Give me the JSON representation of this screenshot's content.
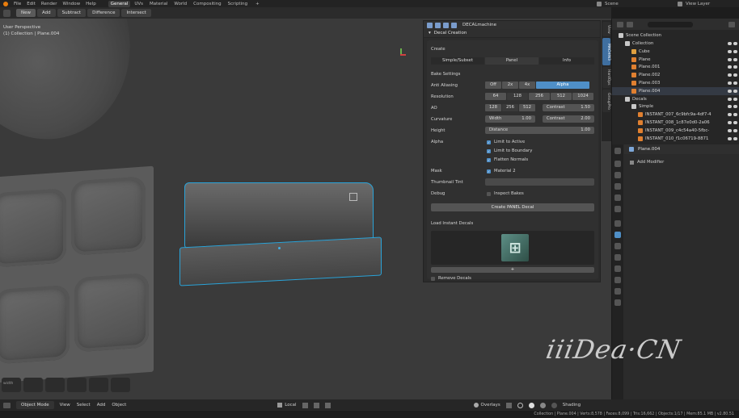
{
  "menus": [
    "File",
    "Edit",
    "Render",
    "Window",
    "Help"
  ],
  "workspaces": [
    "General",
    "UVs",
    "Material",
    "World",
    "Compositing",
    "Scripting"
  ],
  "active_workspace": "General",
  "add_tab_glyph": "+",
  "scene_name": "Scene",
  "view_layer": "View Layer",
  "mode_buttons": [
    "New",
    "Add",
    "Subtract",
    "Difference",
    "Intersect"
  ],
  "viewport": {
    "title": "User Perspective",
    "subtitle": "(1) Collection | Plane.004",
    "hud_text": "width"
  },
  "npanel": {
    "addon_name": "DECALmachine",
    "section": "Decal Creation",
    "create_label": "Create",
    "create_tabs": [
      "Simple/Subset",
      "Panel",
      "Info"
    ],
    "create_active": "Panel",
    "bake_settings": "Bake Settings",
    "anti_aliasing": {
      "label": "Anti Aliasing",
      "options": [
        "Off",
        "2x",
        "4x",
        "Alpha"
      ],
      "active": "Alpha"
    },
    "resolution": {
      "label": "Resolution",
      "options": [
        "64",
        "128",
        "256",
        "512",
        "1024"
      ],
      "active": "128"
    },
    "ao": {
      "label": "AO",
      "options": [
        "128",
        "256",
        "512"
      ],
      "active": "256",
      "contrast_label": "Contrast",
      "contrast_value": "1.50"
    },
    "curvature": {
      "label": "Curvature",
      "width_label": "Width",
      "width_value": "1.00",
      "contrast_label": "Contrast",
      "contrast_value": "2.00"
    },
    "height": {
      "label": "Height",
      "field_label": "Distance",
      "field_value": "1.00"
    },
    "alpha": {
      "label": "Alpha",
      "checks": [
        "Limit to Active",
        "Limit to Boundary",
        "Flatten Normals"
      ]
    },
    "mask": {
      "label": "Mask",
      "check": "Material 2"
    },
    "thumbnail_tint": "Thumbnail Tint",
    "debug": {
      "label": "Debug",
      "check": "Inspect Bakes"
    },
    "create_button": "Create PANEL Decal",
    "load_label": "Load Instant Decals",
    "thumb_glyph": "⊞",
    "add_glyph": "+",
    "remove_label": "Remove Decals"
  },
  "vtabs": [
    "View",
    "MACHIN3",
    "HardOps",
    "GroupPro"
  ],
  "outliner": {
    "root": "Scene Collection",
    "items": [
      {
        "name": "Collection",
        "depth": 1,
        "type": "col"
      },
      {
        "name": "Cube",
        "depth": 2,
        "type": "mesh"
      },
      {
        "name": "Plane",
        "depth": 2,
        "type": "plane"
      },
      {
        "name": "Plane.001",
        "depth": 2,
        "type": "plane"
      },
      {
        "name": "Plane.002",
        "depth": 2,
        "type": "plane"
      },
      {
        "name": "Plane.003",
        "depth": 2,
        "type": "plane"
      },
      {
        "name": "Plane.004",
        "depth": 2,
        "type": "plane",
        "selected": true
      },
      {
        "name": "Decals",
        "depth": 1,
        "type": "col"
      },
      {
        "name": "Simple",
        "depth": 2,
        "type": "col"
      },
      {
        "name": "INSTANT_007_6c9bfc9a-4df7-4",
        "depth": 3,
        "type": "plane"
      },
      {
        "name": "INSTANT_008_1c87e0d0-2a06",
        "depth": 3,
        "type": "plane"
      },
      {
        "name": "INSTANT_009_c4c54a40-5fbc-",
        "depth": 3,
        "type": "plane"
      },
      {
        "name": "INSTANT_010_f1c06719-8871",
        "depth": 3,
        "type": "plane"
      }
    ]
  },
  "properties": {
    "object_name": "Plane.004",
    "add_modifier": "Add Modifier"
  },
  "bottom_bar": {
    "mode": "Object Mode",
    "menus": [
      "View",
      "Select",
      "Add",
      "Object"
    ],
    "orientation": "Local",
    "overlays": "Overlays",
    "shading": "Shading"
  },
  "status": "Collection | Plane.004 | Verts:8,578 | Faces:8,099 | Tris:16,662 | Objects:1/17 | Mem:85.1 MB | v2.80.51",
  "watermark": "iiiDea·CN",
  "colors": {
    "accent": "#4f8fc7",
    "selection": "#2aa3d8",
    "viewport_bg": "#3a3a3a"
  }
}
